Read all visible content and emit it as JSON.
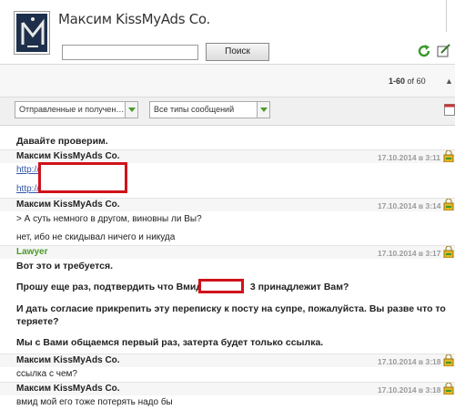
{
  "header": {
    "title": "Максим KissMyAds Co.",
    "search": {
      "value": "",
      "placeholder": ""
    },
    "search_button": "Поиск"
  },
  "pager": {
    "range": "1-60",
    "of_label": "of",
    "total": "60",
    "up_arrow": "▲"
  },
  "filters": {
    "direction": "Отправленные и получен…",
    "message_type": "Все типы сообщений"
  },
  "colors": {
    "accent_green": "#4c9a2a",
    "link": "#3355aa",
    "redaction": "#d0121b"
  },
  "messages": [
    {
      "text": "Давайте проверим."
    },
    {
      "author": "Максим KissMyAds Co.",
      "time": "17.10.2014 в 3:11",
      "link1": "http://",
      "link2": "http://"
    },
    {
      "author": "Максим KissMyAds Co.",
      "time": "17.10.2014 в 3:14",
      "quote": "> А суть немного в другом, виновны ли Вы?",
      "text": "нет, ибо не скидывал ничего и никуда"
    },
    {
      "author": "Lawyer",
      "time": "17.10.2014 в 3:17",
      "p1": "Вот это и требуется.",
      "p2_before": "Прошу еще раз, подтвердить что Вмид 4",
      "p2_after": "3 принадлежит Вам?",
      "p3a": "И дать согласие прикрепить эту переписку к посту на супре, пожалуйста. Вы разве что то",
      "p3b": "теряете?",
      "p4": "Мы с Вами общаемся первый раз, затерта будет только ссылка."
    },
    {
      "author": "Максим KissMyAds Co.",
      "time": "17.10.2014 в 3:18",
      "text": "ссылка с чем?"
    },
    {
      "author": "Максим KissMyAds Co.",
      "time": "17.10.2014 в 3:18",
      "text": "вмид мой его тоже потерять надо бы"
    }
  ]
}
